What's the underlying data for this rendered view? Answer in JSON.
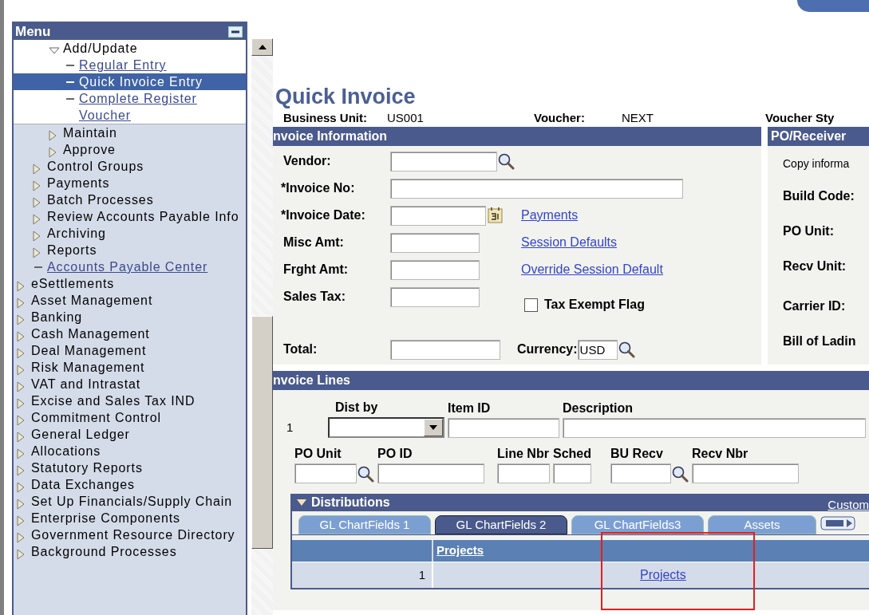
{
  "menu": {
    "title": "Menu",
    "items": [
      {
        "children": [
          {
            "children": [
              {
                "label": "Add/Update",
                "kind": "folder",
                "expanded": true,
                "children": [
                  {
                    "label": "Regular Entry",
                    "kind": "link",
                    "selected": false
                  },
                  {
                    "label": "Quick Invoice Entry",
                    "kind": "link",
                    "selected": true
                  },
                  {
                    "label": "Complete Register Voucher",
                    "kind": "link",
                    "selected": false
                  }
                ]
              },
              {
                "label": "Maintain",
                "kind": "folder",
                "expanded": false
              },
              {
                "label": "Approve",
                "kind": "folder",
                "expanded": false
              }
            ]
          },
          {
            "label": "Control Groups",
            "kind": "folder",
            "expanded": false
          },
          {
            "label": "Payments",
            "kind": "folder",
            "expanded": false
          },
          {
            "label": "Batch Processes",
            "kind": "folder",
            "expanded": false
          },
          {
            "label": "Review Accounts Payable Info",
            "kind": "folder",
            "expanded": false
          },
          {
            "label": "Archiving",
            "kind": "folder",
            "expanded": false
          },
          {
            "label": "Reports",
            "kind": "folder",
            "expanded": false
          },
          {
            "label": "Accounts Payable Center",
            "kind": "link",
            "selected": false
          }
        ]
      },
      {
        "label": "eSettlements",
        "kind": "folder",
        "expanded": false
      },
      {
        "label": "Asset Management",
        "kind": "folder",
        "expanded": false
      },
      {
        "label": "Banking",
        "kind": "folder",
        "expanded": false
      },
      {
        "label": "Cash Management",
        "kind": "folder",
        "expanded": false
      },
      {
        "label": "Deal Management",
        "kind": "folder",
        "expanded": false
      },
      {
        "label": "Risk Management",
        "kind": "folder",
        "expanded": false
      },
      {
        "label": "VAT and Intrastat",
        "kind": "folder",
        "expanded": false
      },
      {
        "label": "Excise and Sales Tax IND",
        "kind": "folder",
        "expanded": false
      },
      {
        "label": "Commitment Control",
        "kind": "folder",
        "expanded": false
      },
      {
        "label": "General Ledger",
        "kind": "folder",
        "expanded": false
      },
      {
        "label": "Allocations",
        "kind": "folder",
        "expanded": false
      },
      {
        "label": "Statutory Reports",
        "kind": "folder",
        "expanded": false
      },
      {
        "label": "Data Exchanges",
        "kind": "folder",
        "expanded": false
      },
      {
        "label": "Set Up Financials/Supply Chain",
        "kind": "folder",
        "expanded": false
      },
      {
        "label": "Enterprise Components",
        "kind": "folder",
        "expanded": false
      },
      {
        "label": "Government Resource Directory",
        "kind": "folder",
        "expanded": false
      },
      {
        "label": "Background Processes",
        "kind": "folder",
        "expanded": false
      }
    ]
  },
  "page": {
    "title": "Quick Invoice",
    "header": [
      {
        "label": "Business Unit:",
        "value": "US001"
      },
      {
        "label": "Voucher:",
        "value": "NEXT"
      },
      {
        "label": "Voucher Sty"
      }
    ]
  },
  "invoice_information": {
    "title": "nvoice Information",
    "fields": [
      {
        "label": "Vendor:",
        "kind": "lookup"
      },
      {
        "label": "*Invoice No:",
        "kind": "text"
      },
      {
        "label": "*Invoice Date:",
        "kind": "date"
      },
      {
        "label": "Misc Amt:",
        "kind": "text"
      },
      {
        "label": "Frght Amt:",
        "kind": "text"
      },
      {
        "label": "Sales Tax:",
        "kind": "text"
      },
      {
        "label": "Total:",
        "kind": "text"
      }
    ],
    "links": [
      "Payments",
      "Session Defaults",
      "Override Session Default"
    ],
    "tax_exempt": {
      "label": "Tax Exempt Flag",
      "checked": false
    },
    "currency": {
      "label": "Currency:",
      "value": "USD"
    }
  },
  "po_receiver": {
    "title": "PO/Receiver",
    "note": "Copy informa",
    "labels": [
      "Build Code:",
      "PO Unit:",
      "Recv Unit:",
      "Carrier ID:",
      "Bill of Ladin"
    ]
  },
  "invoice_lines": {
    "title": "nvoice Lines",
    "row_number": "1",
    "line1": [
      {
        "label": "Dist by",
        "kind": "select"
      },
      {
        "label": "Item ID",
        "kind": "text"
      },
      {
        "label": "Description",
        "kind": "text"
      }
    ],
    "line2": [
      {
        "label": "PO Unit",
        "kind": "lookup"
      },
      {
        "label": "PO ID",
        "kind": "text"
      },
      {
        "label": "Line Nbr",
        "kind": "text"
      },
      {
        "label": "Sched",
        "kind": "text"
      },
      {
        "label": "BU Recv",
        "kind": "lookup"
      },
      {
        "label": "Recv Nbr",
        "kind": "text"
      }
    ],
    "distributions": {
      "title": "Distributions",
      "expanded": true,
      "customize": "Custom",
      "tabs": [
        {
          "label": "GL ChartFields 1",
          "selected": false
        },
        {
          "label": "GL ChartFields 2",
          "selected": true
        },
        {
          "label": "GL ChartFields3",
          "selected": false
        },
        {
          "label": "Assets",
          "selected": false
        }
      ],
      "columns": [
        "Projects"
      ],
      "rows": [
        {
          "number": "1",
          "projects": "Projects"
        }
      ]
    }
  }
}
